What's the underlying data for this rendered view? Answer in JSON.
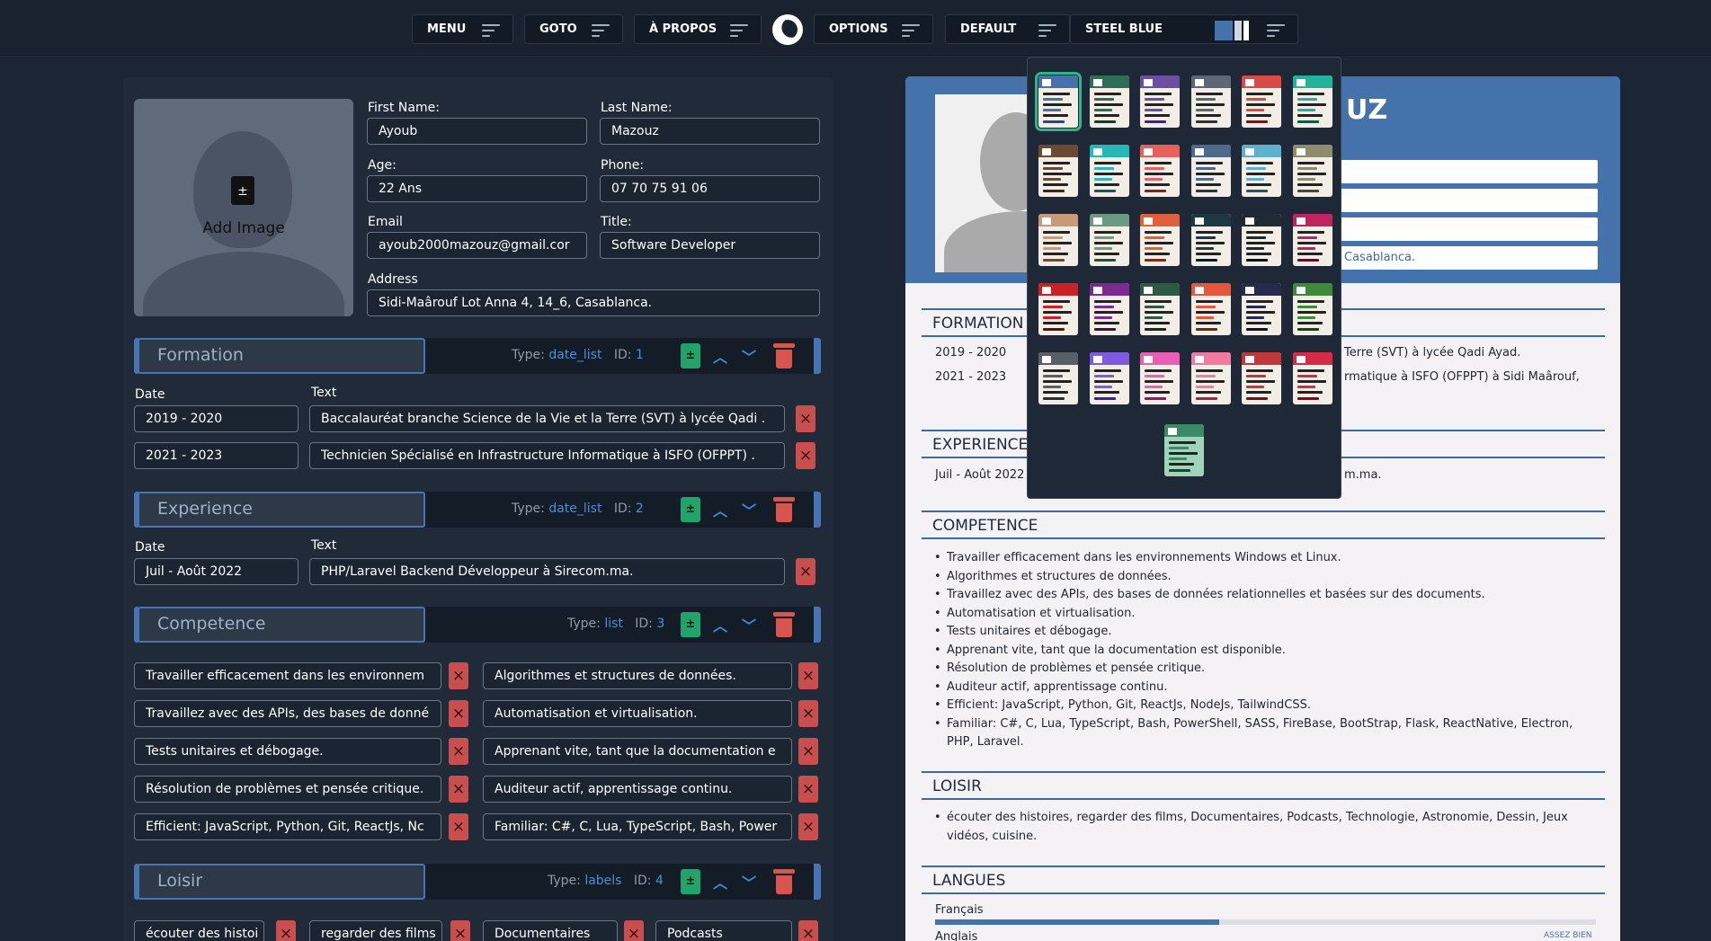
{
  "topbar": {
    "menu": "MENU",
    "goto": "GOTO",
    "apropos": "À PROPOS",
    "options": "OPTIONS",
    "default": "DEFAULT",
    "theme": "STEEL BLUE"
  },
  "profile": {
    "add_image": "Add Image",
    "first_name_label": "First Name:",
    "first_name": "Ayoub",
    "last_name_label": "Last Name:",
    "last_name": "Mazouz",
    "age_label": "Age:",
    "age": "22 Ans",
    "phone_label": "Phone:",
    "phone": "07 70 75 91 06",
    "email_label": "Email",
    "email": "ayoub2000mazouz@gmail.cor",
    "title_label": "Title:",
    "title": "Software Developer",
    "address_label": "Address",
    "address": "Sidi-Maârouf Lot Anna 4, 14_6, Casablanca."
  },
  "sections": {
    "type_label": "Type:",
    "id_label": "ID:",
    "date_label": "Date",
    "text_label": "Text",
    "formation": {
      "title": "Formation",
      "type": "date_list",
      "id": "1",
      "rows": [
        {
          "date": "2019 - 2020",
          "text": "Baccalauréat branche Science de la Vie et la Terre (SVT) à lycée Qadi ."
        },
        {
          "date": "2021 - 2023",
          "text": "Technicien Spécialisé en Infrastructure Informatique à ISFO (OFPPT) ."
        }
      ]
    },
    "experience": {
      "title": "Experience",
      "type": "date_list",
      "id": "2",
      "rows": [
        {
          "date": "Juil - Août 2022",
          "text": "PHP/Laravel Backend Développeur à Sirecom.ma."
        }
      ]
    },
    "competence": {
      "title": "Competence",
      "type": "list",
      "id": "3",
      "items": [
        "Travailler efficacement dans les environnem",
        "Algorithmes et structures de données.",
        "Travaillez avec des APIs, des bases de donné",
        "Automatisation et virtualisation.",
        "Tests unitaires et débogage.",
        "Apprenant vite, tant que la documentation e",
        "Résolution de problèmes et pensée critique.",
        "Auditeur actif, apprentissage continu.",
        "Efficient: JavaScript, Python, Git, ReactJs, Nc",
        "Familiar: C#, C, Lua, TypeScript, Bash, Power"
      ]
    },
    "loisir": {
      "title": "Loisir",
      "type": "labels",
      "id": "4",
      "items": [
        "écouter des histoi",
        "regarder des films",
        "Documentaires",
        "Podcasts"
      ]
    }
  },
  "cv": {
    "name_partial": "UZ",
    "address_partial": "Casablanca.",
    "formation_title": "FORMATION",
    "formation": [
      {
        "date": "2019 - 2020",
        "text": "Terre (SVT) à lycée Qadi Ayad."
      },
      {
        "date": "2021 - 2023",
        "text": "rmatique à ISFO (OFPPT) à Sidi Maârouf,"
      }
    ],
    "experience_title": "EXPERIENCE",
    "experience": [
      {
        "date": "Juil - Août 2022",
        "text": "m.ma."
      }
    ],
    "competence_title": "COMPETENCE",
    "competence": [
      "Travailler efficacement dans les environnements Windows et Linux.",
      "Algorithmes et structures de données.",
      "Travaillez avec des APIs, des bases de données relationnelles et basées sur des documents.",
      "Automatisation et virtualisation.",
      "Tests unitaires et débogage.",
      "Apprenant vite, tant que la documentation est disponible.",
      "Résolution de problèmes et pensée critique.",
      "Auditeur actif, apprentissage continu.",
      "Efficient: JavaScript, Python, Git, ReactJs, NodeJs, TailwindCSS.",
      "Familiar: C#, C, Lua, TypeScript, Bash, PowerShell, SASS, FireBase, BootStrap, Flask, ReactNative, Electron, PHP, Laravel."
    ],
    "loisir_title": "LOISIR",
    "loisir": [
      "écouter des histoires, regarder des films, Documentaires, Podcasts, Technologie, Astronomie, Dessin, Jeux vidéos, cuisine."
    ],
    "langues_title": "LANGUES",
    "lang1": "Français",
    "lang1_level": 0.43,
    "lang2": "Anglais",
    "lang2_level_label": "ASSEZ BIEN"
  },
  "templates": [
    [
      "#4572aa",
      "#2f4a6f"
    ],
    [
      "#2e6e56",
      "#173d30"
    ],
    [
      "#6b4fa3",
      "#3d2a66"
    ],
    [
      "#5d6776",
      "#2c333d"
    ],
    [
      "#d94a46",
      "#6b1c1a"
    ],
    [
      "#23b39c",
      "#0f5a4d"
    ],
    [
      "#6b4a34",
      "#3c2718"
    ],
    [
      "#26b8b8",
      "#0e5c5c"
    ],
    [
      "#e8605e",
      "#7a2624"
    ],
    [
      "#4d6a8c",
      "#263648"
    ],
    [
      "#5eb0cf",
      "#24566a"
    ],
    [
      "#8f8b6f",
      "#4a4736"
    ],
    [
      "#c89a7a",
      "#6f4b33"
    ],
    [
      "#6a9a80",
      "#2f4c3d"
    ],
    [
      "#e0603a",
      "#7a2e17"
    ],
    [
      "#1d3a44",
      "#0c1c21"
    ],
    [
      "#1f2a33",
      "#0c1216"
    ],
    [
      "#c0245f",
      "#5c0f2d"
    ],
    [
      "#cc2027",
      "#5e0d10"
    ],
    [
      "#7b2a8f",
      "#3a1244"
    ],
    [
      "#2e5a45",
      "#152b20"
    ],
    [
      "#e4573a",
      "#6f2716"
    ],
    [
      "#262a4f",
      "#10132a"
    ],
    [
      "#3f8a3a",
      "#1b3f18"
    ],
    [
      "#5a5f66",
      "#2b2e32"
    ],
    [
      "#7d5ae0",
      "#3a2a70"
    ],
    [
      "#e85fb3",
      "#73285a"
    ],
    [
      "#f27aa0",
      "#7a3450"
    ],
    [
      "#c2383a",
      "#5e181a"
    ],
    [
      "#d62a48",
      "#6a1020"
    ],
    [
      "#3a8a68",
      "#1b4533"
    ]
  ]
}
